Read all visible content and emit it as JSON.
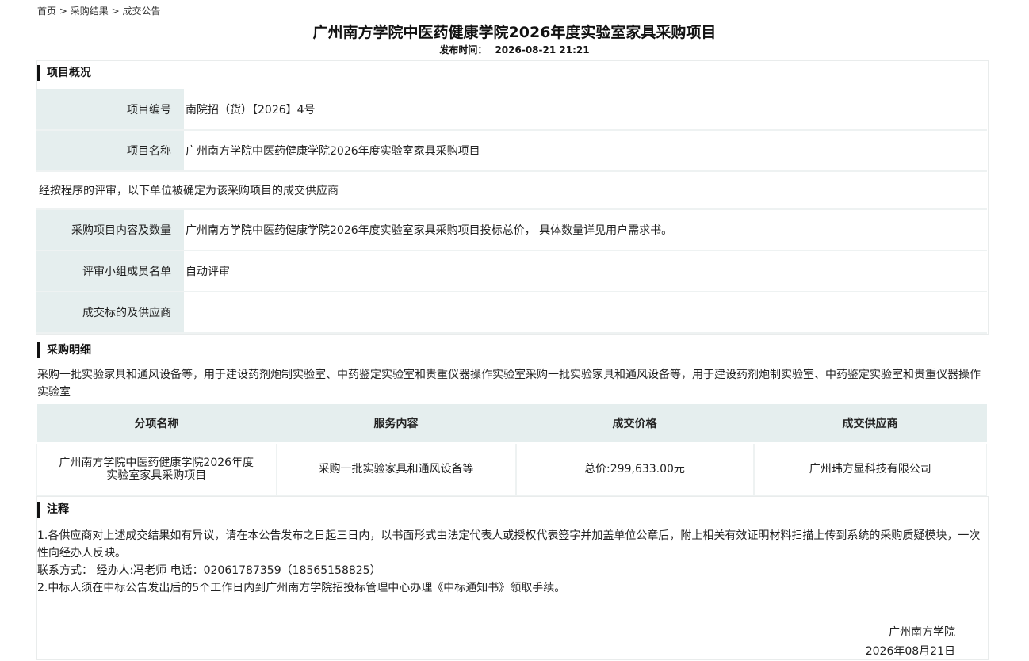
{
  "breadcrumb": {
    "home": "首页",
    "results": "采购结果",
    "current": "成交公告",
    "sep": ">"
  },
  "title": "广州南方学院中医药健康学院2026年度实验室家具采购项目",
  "publish": {
    "label": "发布时间：",
    "value": "2026-08-21 21:21"
  },
  "overview": {
    "heading": "项目概况",
    "project_no_label": "项目编号",
    "project_no": "南院招（货）【2026】4号",
    "project_name_label": "项目名称",
    "project_name": "广州南方学院中医药健康学院2026年度实验室家具采购项目",
    "statement": "经按程序的评审，以下单位被确定为该采购项目的成交供应商",
    "content_label": "采购项目内容及数量",
    "content": "广州南方学院中医药健康学院2026年度实验室家具采购项目投标总价， 具体数量详见用户需求书。",
    "panel_label": "评审小组成员名单",
    "panel": "自动评审",
    "winner_label": "成交标的及供应商",
    "winner": ""
  },
  "detail": {
    "heading": "采购明细",
    "text": "采购一批实验家具和通风设备等，用于建设药剂炮制实验室、中药鉴定实验室和贵重仪器操作实验室采购一批实验家具和通风设备等，用于建设药剂炮制实验室、中药鉴定实验室和贵重仪器操作实验室",
    "columns": [
      "分项名称",
      "服务内容",
      "成交价格",
      "成交供应商"
    ],
    "row": {
      "name_line1": "广州南方学院中医药健康学院2026年度",
      "name_line2": "实验室家具采购项目",
      "service": "采购一批实验家具和通风设备等",
      "price": "总价:299,633.00元",
      "supplier": "广州玮方显科技有限公司"
    }
  },
  "notes": {
    "heading": "注释",
    "item1": "1.各供应商对上述成交结果如有异议，请在本公告发布之日起三日内，以书面形式由法定代表人或授权代表签字并加盖单位公章后，附上相关有效证明材料扫描上传到系统的采购质疑模块，一次性向经办人反映。",
    "contact": "联系方式： 经办人:冯老师 电话：02061787359（18565158825）",
    "item2": "2.中标人须在中标公告发出后的5个工作日内到广州南方学院招投标管理中心办理《中标通知书》领取手续。"
  },
  "signature": {
    "org": "广州南方学院",
    "date": "2026年08月21日"
  }
}
